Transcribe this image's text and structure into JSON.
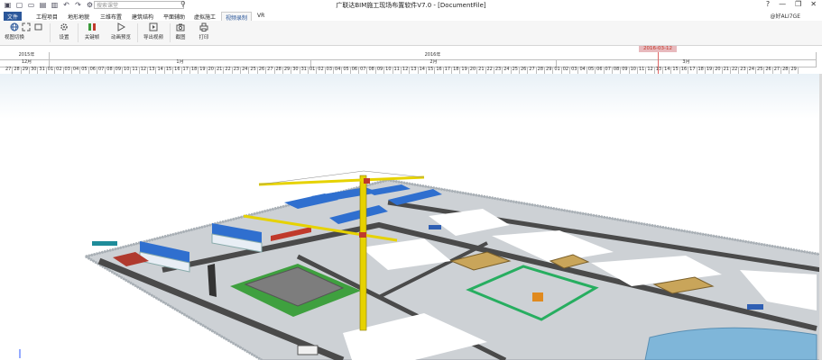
{
  "titlebar": {
    "title": "广联达BIM施工现场布置软件V7.0 - [DocumentFile]",
    "search_placeholder": "搜索课堂",
    "quick_access_icons": [
      "app-icon",
      "new-file-icon",
      "open-folder-icon",
      "save-icon",
      "save-as-icon",
      "undo-icon",
      "redo-icon",
      "settings-icon"
    ]
  },
  "menu": {
    "tabs": [
      "文件",
      "工程项目",
      "地形地貌",
      "三维布置",
      "建筑结构",
      "平面辅助",
      "虚拟施工",
      "视频录制",
      "VR"
    ],
    "active_tab": "视频录制",
    "user": "@好ALI7GE"
  },
  "ribbon": {
    "buttons": [
      {
        "label": "视图切换",
        "icon": "globe-icon"
      },
      {
        "label": "设置",
        "icon": "gear-icon"
      },
      {
        "label": "关键帧",
        "icon": "keyframe-icon"
      },
      {
        "label": "动画预览",
        "icon": "play-icon"
      },
      {
        "label": "导出视频",
        "icon": "export-video-icon"
      },
      {
        "label": "截图",
        "icon": "camera-icon"
      },
      {
        "label": "打印",
        "icon": "printer-icon"
      }
    ]
  },
  "timeline": {
    "years": [
      {
        "label": "2015年"
      },
      {
        "label": "2016年"
      }
    ],
    "months": [
      "12月",
      "1月",
      "2月",
      "3月"
    ],
    "days_dec": [
      "27",
      "28",
      "29",
      "30",
      "31"
    ],
    "days_jan": [
      "01",
      "02",
      "03",
      "04",
      "05",
      "06",
      "07",
      "08",
      "09",
      "10",
      "11",
      "12",
      "13",
      "14",
      "15",
      "16",
      "17",
      "18",
      "19",
      "20",
      "21",
      "22",
      "23",
      "24",
      "25",
      "26",
      "27",
      "28",
      "29",
      "30",
      "31"
    ],
    "days_feb": [
      "01",
      "02",
      "03",
      "04",
      "05",
      "06",
      "07",
      "08",
      "09",
      "10",
      "11",
      "12",
      "13",
      "14",
      "15",
      "16",
      "17",
      "18",
      "19",
      "20",
      "21",
      "22",
      "23",
      "24",
      "25",
      "26",
      "27",
      "28",
      "29"
    ],
    "days_mar": [
      "01",
      "02",
      "03",
      "04",
      "05",
      "06",
      "07",
      "08",
      "09",
      "10",
      "11",
      "12",
      "13",
      "14",
      "15",
      "16",
      "17",
      "18",
      "19",
      "20",
      "21",
      "22",
      "23",
      "24",
      "25",
      "26",
      "27",
      "28",
      "29"
    ],
    "current_date": "2016-03-12"
  },
  "colors": {
    "accent": "#2b579a",
    "marker": "#e8b9bd",
    "crane": "#e6d200",
    "road": "#4a4a4a",
    "ground": "#cfd3d7"
  }
}
